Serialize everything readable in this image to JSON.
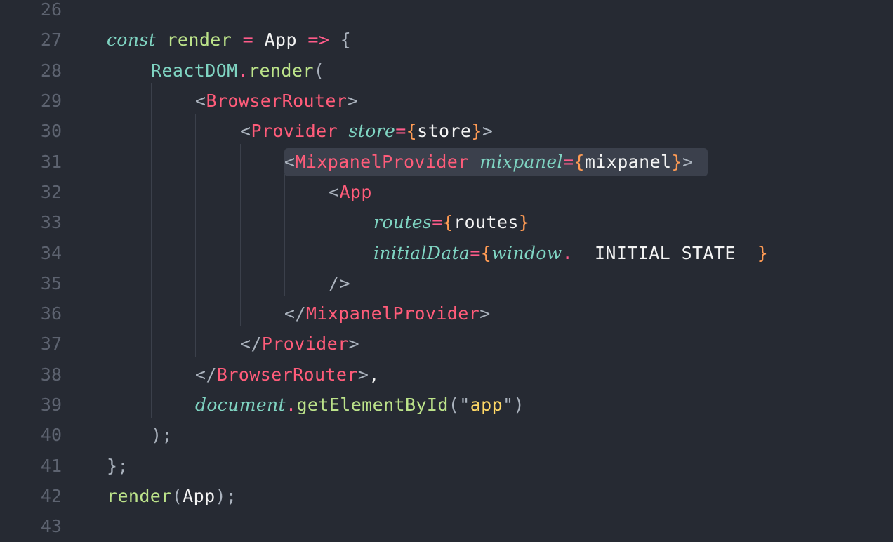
{
  "editor": {
    "language": "javascript-jsx",
    "colors": {
      "background": "#262a33",
      "line_number": "#5d6370",
      "keyword": "#7fd4c2",
      "function": "#bce38a",
      "operator": "#ff5c8a",
      "jsx_tag": "#ff5c7a",
      "brace": "#ff9b54",
      "string": "#ffd866",
      "selection_highlight": "#3b404c"
    },
    "highlighted_line": "31",
    "lines": [
      {
        "num": "26",
        "tokens": []
      },
      {
        "num": "27",
        "tokens": [
          [
            "kw",
            "const"
          ],
          [
            "plain",
            " "
          ],
          [
            "fn",
            "render"
          ],
          [
            "plain",
            " "
          ],
          [
            "op",
            "="
          ],
          [
            "plain",
            " "
          ],
          [
            "var",
            "App"
          ],
          [
            "plain",
            " "
          ],
          [
            "op",
            "=>"
          ],
          [
            "plain",
            " "
          ],
          [
            "punc",
            "{"
          ]
        ]
      },
      {
        "num": "28",
        "tokens": [
          [
            "obj",
            "ReactDOM"
          ],
          [
            "op",
            "."
          ],
          [
            "fn",
            "render"
          ],
          [
            "punc",
            "("
          ]
        ]
      },
      {
        "num": "29",
        "tokens": [
          [
            "punc",
            "<"
          ],
          [
            "tag",
            "BrowserRouter"
          ],
          [
            "punc",
            ">"
          ]
        ]
      },
      {
        "num": "30",
        "tokens": [
          [
            "punc",
            "<"
          ],
          [
            "tag",
            "Provider"
          ],
          [
            "plain",
            " "
          ],
          [
            "attr",
            "store"
          ],
          [
            "op",
            "="
          ],
          [
            "brace",
            "{"
          ],
          [
            "var",
            "store"
          ],
          [
            "brace",
            "}"
          ],
          [
            "punc",
            ">"
          ]
        ]
      },
      {
        "num": "31",
        "tokens": [
          [
            "punc",
            "<"
          ],
          [
            "tag",
            "MixpanelProvider"
          ],
          [
            "plain",
            " "
          ],
          [
            "attr",
            "mixpanel"
          ],
          [
            "op",
            "="
          ],
          [
            "brace",
            "{"
          ],
          [
            "var",
            "mixpanel"
          ],
          [
            "brace",
            "}"
          ],
          [
            "punc",
            ">"
          ]
        ]
      },
      {
        "num": "32",
        "tokens": [
          [
            "punc",
            "<"
          ],
          [
            "tag",
            "App"
          ]
        ]
      },
      {
        "num": "33",
        "tokens": [
          [
            "attr",
            "routes"
          ],
          [
            "op",
            "="
          ],
          [
            "brace",
            "{"
          ],
          [
            "var",
            "routes"
          ],
          [
            "brace",
            "}"
          ]
        ]
      },
      {
        "num": "34",
        "tokens": [
          [
            "attr",
            "initialData"
          ],
          [
            "op",
            "="
          ],
          [
            "brace",
            "{"
          ],
          [
            "glob",
            "window"
          ],
          [
            "op",
            "."
          ],
          [
            "var",
            "__INITIAL_STATE__"
          ],
          [
            "brace",
            "}"
          ]
        ]
      },
      {
        "num": "35",
        "tokens": [
          [
            "punc",
            "/>"
          ]
        ]
      },
      {
        "num": "36",
        "tokens": [
          [
            "punc",
            "</"
          ],
          [
            "tag",
            "MixpanelProvider"
          ],
          [
            "punc",
            ">"
          ]
        ]
      },
      {
        "num": "37",
        "tokens": [
          [
            "punc",
            "</"
          ],
          [
            "tag",
            "Provider"
          ],
          [
            "punc",
            ">"
          ]
        ]
      },
      {
        "num": "38",
        "tokens": [
          [
            "punc",
            "</"
          ],
          [
            "tag",
            "BrowserRouter"
          ],
          [
            "punc",
            ">"
          ],
          [
            "plain",
            ","
          ]
        ]
      },
      {
        "num": "39",
        "tokens": [
          [
            "glob",
            "document"
          ],
          [
            "op",
            "."
          ],
          [
            "fn",
            "getElementById"
          ],
          [
            "punc",
            "("
          ],
          [
            "punc",
            "\""
          ],
          [
            "str",
            "app"
          ],
          [
            "punc",
            "\""
          ],
          [
            "punc",
            ")"
          ]
        ]
      },
      {
        "num": "40",
        "tokens": [
          [
            "punc",
            ");"
          ]
        ]
      },
      {
        "num": "41",
        "tokens": [
          [
            "punc",
            "};"
          ]
        ]
      },
      {
        "num": "42",
        "tokens": [
          [
            "fn",
            "render"
          ],
          [
            "punc",
            "("
          ],
          [
            "var",
            "App"
          ],
          [
            "punc",
            ");"
          ]
        ]
      },
      {
        "num": "43",
        "tokens": []
      }
    ]
  }
}
